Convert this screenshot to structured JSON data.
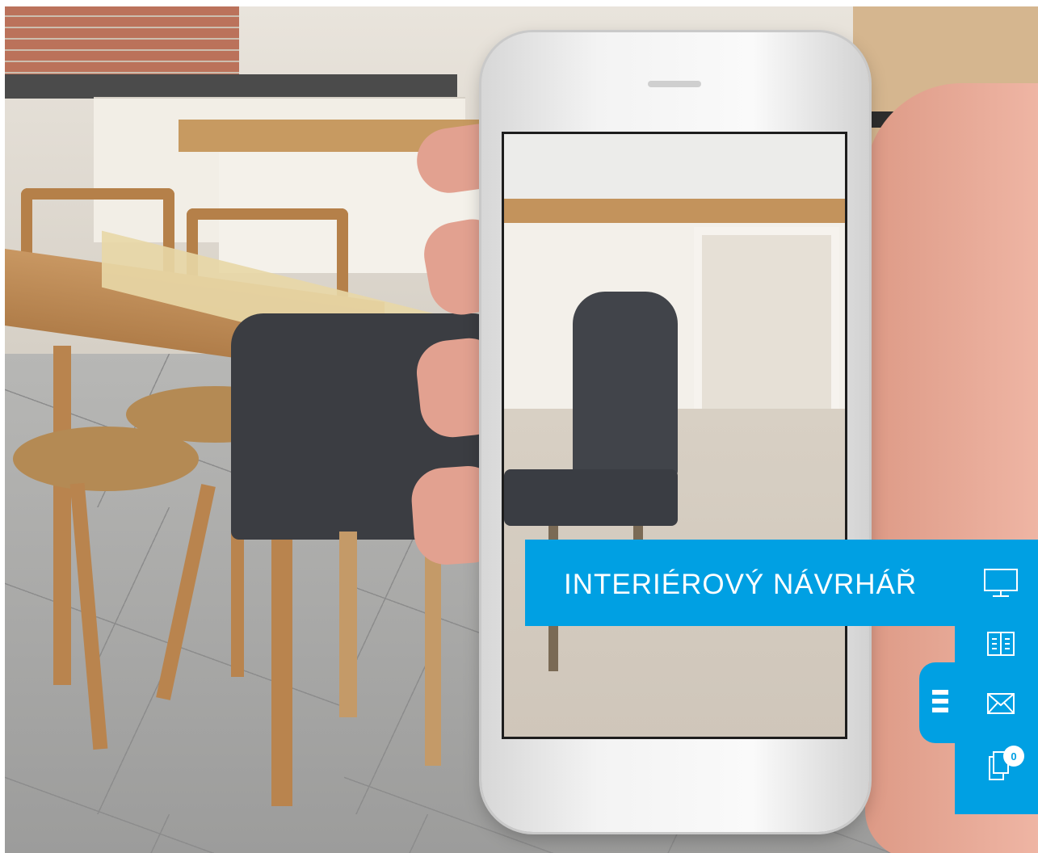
{
  "banner": {
    "title": "INTERIÉROVÝ NÁVRHÁŘ"
  },
  "toolbar": {
    "items": [
      {
        "name": "monitor-icon",
        "label": ""
      },
      {
        "name": "catalog-icon",
        "label": ""
      },
      {
        "name": "mail-icon",
        "label": ""
      },
      {
        "name": "samples-icon",
        "label": ""
      }
    ],
    "samples_count": "0",
    "menu_icon": "hamburger-icon"
  },
  "colors": {
    "accent": "#00a0e3",
    "icon": "#ffffff"
  }
}
